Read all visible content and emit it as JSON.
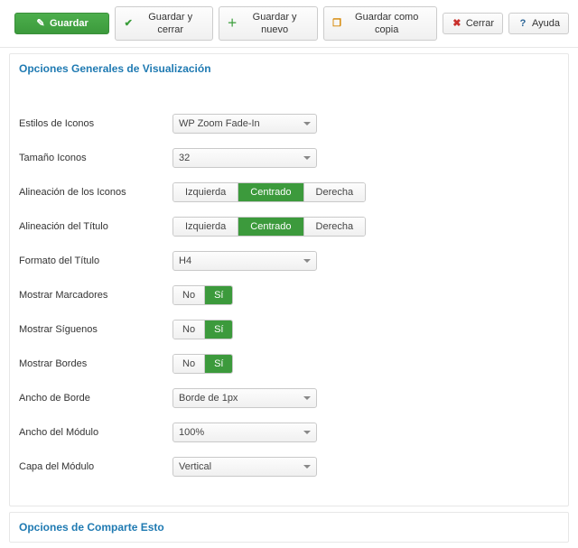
{
  "toolbar": {
    "save": "Guardar",
    "save_close": "Guardar y cerrar",
    "save_new": "Guardar y nuevo",
    "save_copy": "Guardar como copia",
    "close": "Cerrar",
    "help": "Ayuda"
  },
  "panels": {
    "general_title": "Opciones Generales de Visualización",
    "share_title": "Opciones de Comparte Esto"
  },
  "fields": {
    "icon_style": {
      "label": "Estilos de Iconos",
      "value": "WP Zoom Fade-In"
    },
    "icon_size": {
      "label": "Tamaño Iconos",
      "value": "32"
    },
    "icon_align": {
      "label": "Alineación de los Iconos",
      "left": "Izquierda",
      "center": "Centrado",
      "right": "Derecha"
    },
    "title_align": {
      "label": "Alineación del Título",
      "left": "Izquierda",
      "center": "Centrado",
      "right": "Derecha"
    },
    "title_fmt": {
      "label": "Formato del Título",
      "value": "H4"
    },
    "bookmarks": {
      "label": "Mostrar Marcadores",
      "no": "No",
      "yes": "Sí"
    },
    "followus": {
      "label": "Mostrar Síguenos",
      "no": "No",
      "yes": "Sí"
    },
    "borders": {
      "label": "Mostrar Bordes",
      "no": "No",
      "yes": "Sí"
    },
    "border_w": {
      "label": "Ancho de Borde",
      "value": "Borde de 1px"
    },
    "module_w": {
      "label": "Ancho del Módulo",
      "value": "100%"
    },
    "module_layer": {
      "label": "Capa del Módulo",
      "value": "Vertical"
    }
  }
}
